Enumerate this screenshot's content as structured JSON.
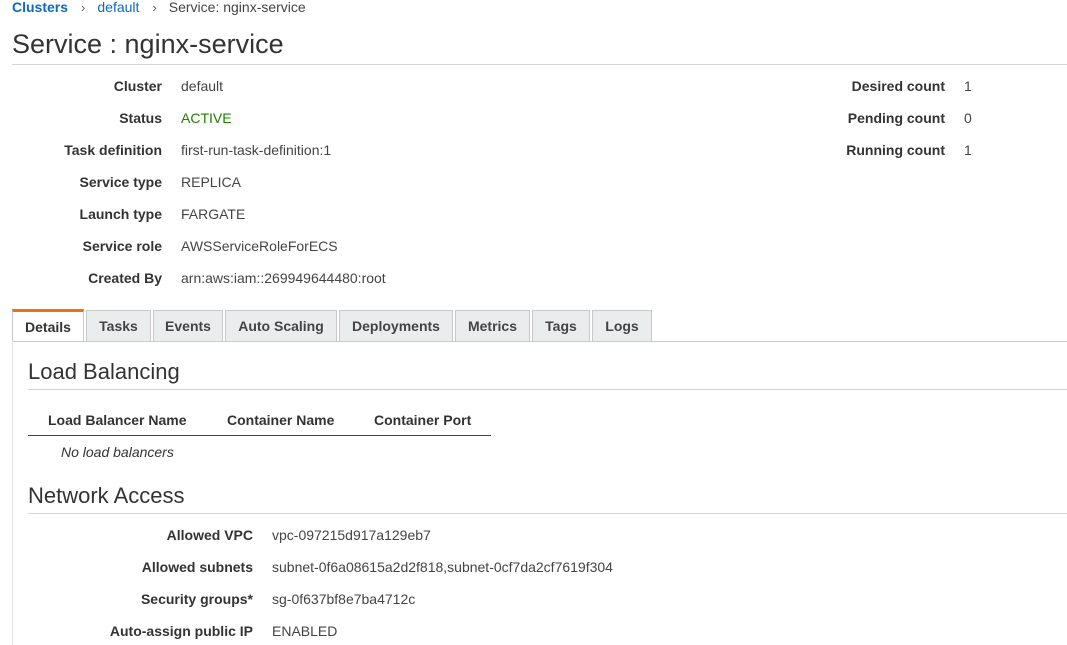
{
  "breadcrumb": {
    "items": [
      "Clusters",
      "default",
      "Service: nginx-service"
    ],
    "separator": "›"
  },
  "page_title": "Service : nginx-service",
  "details": {
    "cluster_label": "Cluster",
    "cluster_value": "default",
    "status_label": "Status",
    "status_value": "ACTIVE",
    "task_definition_label": "Task definition",
    "task_definition_value": "first-run-task-definition:1",
    "service_type_label": "Service type",
    "service_type_value": "REPLICA",
    "launch_type_label": "Launch type",
    "launch_type_value": "FARGATE",
    "service_role_label": "Service role",
    "service_role_value": "AWSServiceRoleForECS",
    "created_by_label": "Created By",
    "created_by_value": "arn:aws:iam::269949644480:root"
  },
  "counts": {
    "desired_label": "Desired count",
    "desired_value": "1",
    "pending_label": "Pending count",
    "pending_value": "0",
    "running_label": "Running count",
    "running_value": "1"
  },
  "tabs": [
    {
      "label": "Details",
      "selected": true
    },
    {
      "label": "Tasks"
    },
    {
      "label": "Events"
    },
    {
      "label": "Auto Scaling"
    },
    {
      "label": "Deployments"
    },
    {
      "label": "Metrics"
    },
    {
      "label": "Tags"
    },
    {
      "label": "Logs"
    }
  ],
  "load_balancing": {
    "title": "Load Balancing",
    "columns": [
      "Load Balancer Name",
      "Container Name",
      "Container Port"
    ],
    "empty_text": "No load balancers"
  },
  "network_access": {
    "title": "Network Access",
    "allowed_vpc_label": "Allowed VPC",
    "allowed_vpc_value": "vpc-097215d917a129eb7",
    "allowed_subnets_label": "Allowed subnets",
    "allowed_subnets_value": "subnet-0f6a08615a2d2f818,subnet-0cf7da2cf7619f304",
    "security_groups_label": "Security groups*",
    "security_groups_value": "sg-0f637bf8e7ba4712c",
    "auto_assign_label": "Auto-assign public IP",
    "auto_assign_value": "ENABLED"
  },
  "colors": {
    "link": "#0d6bbd",
    "active": "#1d8102",
    "tab_accent": "#ec7211"
  }
}
